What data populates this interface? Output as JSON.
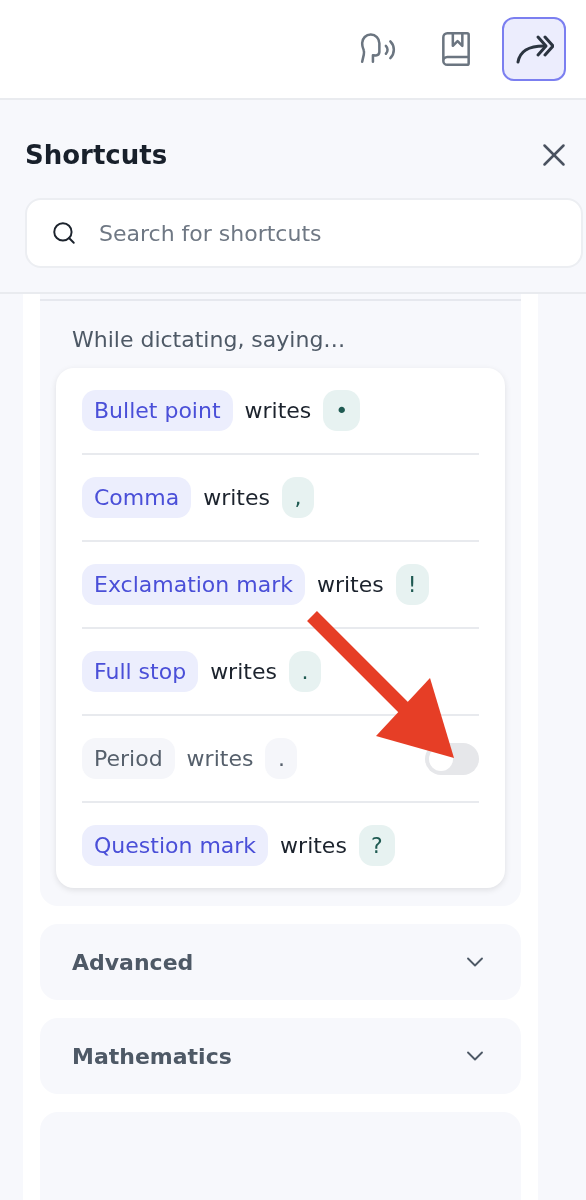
{
  "toolbar": {
    "buttons": [
      {
        "kind": "voice",
        "selected": false
      },
      {
        "kind": "book",
        "selected": false
      },
      {
        "kind": "forward",
        "selected": true
      }
    ]
  },
  "panel": {
    "title": "Shortcuts",
    "search": {
      "placeholder": "Search for shortcuts"
    }
  },
  "sections": [
    {
      "expanded": true,
      "intro": "While dictating, saying…",
      "rows": [
        {
          "phrase": "Bullet point",
          "verb": "writes",
          "output": "•",
          "enabled": true
        },
        {
          "phrase": "Comma",
          "verb": "writes",
          "output": ",",
          "enabled": true
        },
        {
          "phrase": "Exclamation mark",
          "verb": "writes",
          "output": "!",
          "enabled": true
        },
        {
          "phrase": "Full stop",
          "verb": "writes",
          "output": ".",
          "enabled": true
        },
        {
          "phrase": "Period",
          "verb": "writes",
          "output": ".",
          "enabled": false,
          "toggle": {
            "on": false
          }
        },
        {
          "phrase": "Question mark",
          "verb": "writes",
          "output": "?",
          "enabled": true
        }
      ]
    },
    {
      "title": "Advanced",
      "expanded": false
    },
    {
      "title": "Mathematics",
      "expanded": false
    },
    {
      "expanded": false
    }
  ]
}
